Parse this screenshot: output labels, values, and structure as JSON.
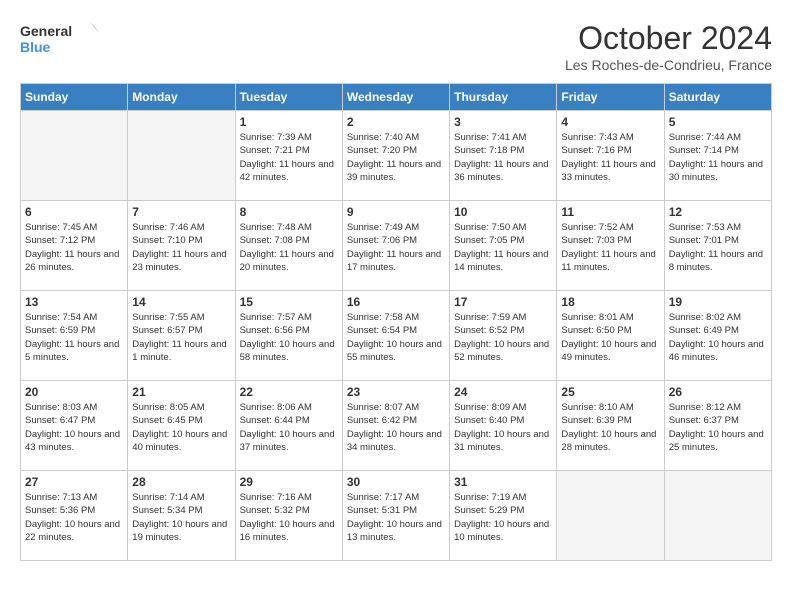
{
  "header": {
    "logo_line1": "General",
    "logo_line2": "Blue",
    "month": "October 2024",
    "location": "Les Roches-de-Condrieu, France"
  },
  "weekdays": [
    "Sunday",
    "Monday",
    "Tuesday",
    "Wednesday",
    "Thursday",
    "Friday",
    "Saturday"
  ],
  "weeks": [
    [
      {
        "day": "",
        "empty": true
      },
      {
        "day": "",
        "empty": true
      },
      {
        "day": "1",
        "sunrise": "7:39 AM",
        "sunset": "7:21 PM",
        "daylight": "11 hours and 42 minutes."
      },
      {
        "day": "2",
        "sunrise": "7:40 AM",
        "sunset": "7:20 PM",
        "daylight": "11 hours and 39 minutes."
      },
      {
        "day": "3",
        "sunrise": "7:41 AM",
        "sunset": "7:18 PM",
        "daylight": "11 hours and 36 minutes."
      },
      {
        "day": "4",
        "sunrise": "7:43 AM",
        "sunset": "7:16 PM",
        "daylight": "11 hours and 33 minutes."
      },
      {
        "day": "5",
        "sunrise": "7:44 AM",
        "sunset": "7:14 PM",
        "daylight": "11 hours and 30 minutes."
      }
    ],
    [
      {
        "day": "6",
        "sunrise": "7:45 AM",
        "sunset": "7:12 PM",
        "daylight": "11 hours and 26 minutes."
      },
      {
        "day": "7",
        "sunrise": "7:46 AM",
        "sunset": "7:10 PM",
        "daylight": "11 hours and 23 minutes."
      },
      {
        "day": "8",
        "sunrise": "7:48 AM",
        "sunset": "7:08 PM",
        "daylight": "11 hours and 20 minutes."
      },
      {
        "day": "9",
        "sunrise": "7:49 AM",
        "sunset": "7:06 PM",
        "daylight": "11 hours and 17 minutes."
      },
      {
        "day": "10",
        "sunrise": "7:50 AM",
        "sunset": "7:05 PM",
        "daylight": "11 hours and 14 minutes."
      },
      {
        "day": "11",
        "sunrise": "7:52 AM",
        "sunset": "7:03 PM",
        "daylight": "11 hours and 11 minutes."
      },
      {
        "day": "12",
        "sunrise": "7:53 AM",
        "sunset": "7:01 PM",
        "daylight": "11 hours and 8 minutes."
      }
    ],
    [
      {
        "day": "13",
        "sunrise": "7:54 AM",
        "sunset": "6:59 PM",
        "daylight": "11 hours and 5 minutes."
      },
      {
        "day": "14",
        "sunrise": "7:55 AM",
        "sunset": "6:57 PM",
        "daylight": "11 hours and 1 minute."
      },
      {
        "day": "15",
        "sunrise": "7:57 AM",
        "sunset": "6:56 PM",
        "daylight": "10 hours and 58 minutes."
      },
      {
        "day": "16",
        "sunrise": "7:58 AM",
        "sunset": "6:54 PM",
        "daylight": "10 hours and 55 minutes."
      },
      {
        "day": "17",
        "sunrise": "7:59 AM",
        "sunset": "6:52 PM",
        "daylight": "10 hours and 52 minutes."
      },
      {
        "day": "18",
        "sunrise": "8:01 AM",
        "sunset": "6:50 PM",
        "daylight": "10 hours and 49 minutes."
      },
      {
        "day": "19",
        "sunrise": "8:02 AM",
        "sunset": "6:49 PM",
        "daylight": "10 hours and 46 minutes."
      }
    ],
    [
      {
        "day": "20",
        "sunrise": "8:03 AM",
        "sunset": "6:47 PM",
        "daylight": "10 hours and 43 minutes."
      },
      {
        "day": "21",
        "sunrise": "8:05 AM",
        "sunset": "6:45 PM",
        "daylight": "10 hours and 40 minutes."
      },
      {
        "day": "22",
        "sunrise": "8:06 AM",
        "sunset": "6:44 PM",
        "daylight": "10 hours and 37 minutes."
      },
      {
        "day": "23",
        "sunrise": "8:07 AM",
        "sunset": "6:42 PM",
        "daylight": "10 hours and 34 minutes."
      },
      {
        "day": "24",
        "sunrise": "8:09 AM",
        "sunset": "6:40 PM",
        "daylight": "10 hours and 31 minutes."
      },
      {
        "day": "25",
        "sunrise": "8:10 AM",
        "sunset": "6:39 PM",
        "daylight": "10 hours and 28 minutes."
      },
      {
        "day": "26",
        "sunrise": "8:12 AM",
        "sunset": "6:37 PM",
        "daylight": "10 hours and 25 minutes."
      }
    ],
    [
      {
        "day": "27",
        "sunrise": "7:13 AM",
        "sunset": "5:36 PM",
        "daylight": "10 hours and 22 minutes."
      },
      {
        "day": "28",
        "sunrise": "7:14 AM",
        "sunset": "5:34 PM",
        "daylight": "10 hours and 19 minutes."
      },
      {
        "day": "29",
        "sunrise": "7:16 AM",
        "sunset": "5:32 PM",
        "daylight": "10 hours and 16 minutes."
      },
      {
        "day": "30",
        "sunrise": "7:17 AM",
        "sunset": "5:31 PM",
        "daylight": "10 hours and 13 minutes."
      },
      {
        "day": "31",
        "sunrise": "7:19 AM",
        "sunset": "5:29 PM",
        "daylight": "10 hours and 10 minutes."
      },
      {
        "day": "",
        "empty": true
      },
      {
        "day": "",
        "empty": true
      }
    ]
  ]
}
